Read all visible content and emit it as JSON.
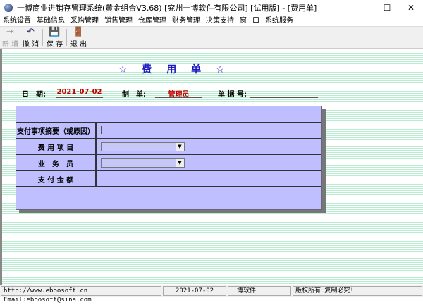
{
  "window": {
    "title": "一博商业进销存管理系统(黄金组合V3.68)    [兖州一博软件有限公司]  [试用版]  - [费用单]",
    "minimize": "—",
    "maximize": "☐",
    "close": "✕"
  },
  "menu": [
    "系统设置",
    "基础信息",
    "采购管理",
    "销售管理",
    "仓库管理",
    "财务管理",
    "决策支持",
    "窗",
    "口",
    "系统服务"
  ],
  "toolbar": [
    {
      "label": "新 增",
      "icon": "add-icon",
      "glyph": "⇥",
      "disabled": true
    },
    {
      "label": "撤 消",
      "icon": "undo-icon",
      "glyph": "↶"
    },
    {
      "label": "保 存",
      "icon": "save-icon",
      "glyph": "💾"
    },
    {
      "label": "退 出",
      "icon": "exit-icon",
      "glyph": "🚪"
    }
  ],
  "form": {
    "title": "☆ 费 用 单 ☆",
    "date_label": "日　期:",
    "date": "2021-07-02",
    "maker_label": "制　单:",
    "maker": "管理员",
    "doc_no_label": "单 据 号:",
    "doc_no": "",
    "rows": [
      {
        "label": "支付事项摘要（或原因）",
        "value": ""
      },
      {
        "label": "费 用 项 目",
        "value": ""
      },
      {
        "label": "业　务　员",
        "value": ""
      },
      {
        "label": "支 付 金 额",
        "value": ""
      }
    ]
  },
  "status": {
    "url": "http://www.eboosoft.cn   Email:eboosoft@sina.com",
    "date": "2021-07-02",
    "company": "一博软件",
    "copyright": "版权所有  复制必究!"
  },
  "colors": {
    "form_bg": "#bfbfff",
    "title": "#1a1ac0",
    "value": "#c00000",
    "stripe": "#b8ecd0"
  }
}
